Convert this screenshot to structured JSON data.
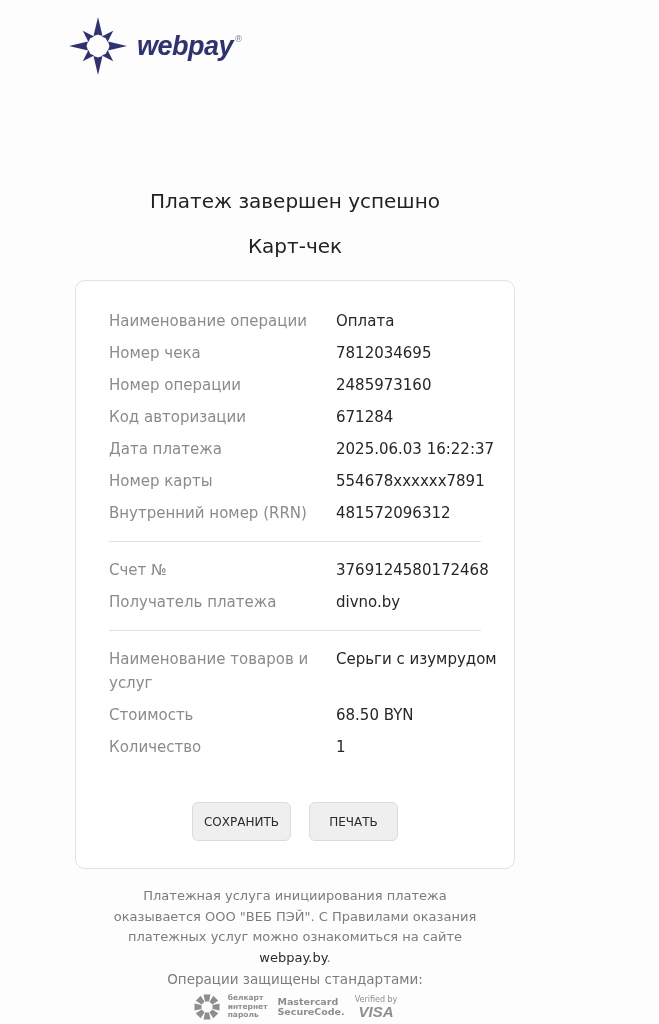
{
  "logo": {
    "text": "webpay",
    "registered": "®"
  },
  "title": "Платеж завершен успешно",
  "subtitle": "Карт-чек",
  "receipt": {
    "groups": [
      {
        "rows": [
          {
            "label": "Наименование операции",
            "value": "Оплата"
          },
          {
            "label": "Номер чека",
            "value": "7812034695"
          },
          {
            "label": "Номер операции",
            "value": "2485973160"
          },
          {
            "label": "Код авторизации",
            "value": "671284"
          },
          {
            "label": "Дата платежа",
            "value": "2025.06.03 16:22:37"
          },
          {
            "label": "Номер карты",
            "value": "554678xxxxxx7891"
          },
          {
            "label": "Внутренний номер (RRN)",
            "value": "481572096312"
          }
        ]
      },
      {
        "rows": [
          {
            "label": "Счет №",
            "value": "3769124580172468"
          },
          {
            "label": "Получатель платежа",
            "value": "divno.by"
          }
        ]
      },
      {
        "rows": [
          {
            "label": "Наименование товаров и услуг",
            "value": "Серьги с изумрудом"
          },
          {
            "label": "Стоимость",
            "value": "68.50 BYN"
          },
          {
            "label": "Количество",
            "value": "1"
          }
        ]
      }
    ],
    "buttons": [
      {
        "label": "СОХРАНИТЬ"
      },
      {
        "label": "ПЕЧАТЬ"
      }
    ]
  },
  "footer": {
    "notice": {
      "text": "Платежная услуга инициирования платежа оказывается ООО \"ВЕБ ПЭЙ\". С Правилами оказания платежных услуг можно ознакомиться на сайте",
      "link": "webpay.by",
      "after": "."
    },
    "standards_label": "Операции защищены стандартами:",
    "standards": [
      {
        "kind": "belkart",
        "text": "белкарт интернет пароль"
      },
      {
        "kind": "mastercard",
        "text": "Mastercard SecureCode."
      },
      {
        "kind": "visa",
        "text": "Verified by",
        "brand": "VISA"
      }
    ]
  }
}
